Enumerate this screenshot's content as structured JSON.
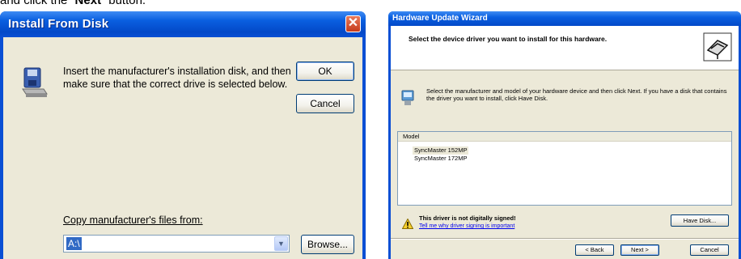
{
  "caption": {
    "prefix": "and click the “",
    "bold": "Next",
    "suffix": "” button."
  },
  "install_dialog": {
    "title": "Install From Disk",
    "close_icon": "close-icon",
    "message": "Insert the manufacturer's installation disk, and then make sure that the correct drive is selected below.",
    "ok_label": "OK",
    "cancel_label": "Cancel",
    "copy_label": "Copy manufacturer's files from:",
    "path_value": "A:\\",
    "browse_label": "Browse..."
  },
  "wizard": {
    "title": "Hardware Update Wizard",
    "heading": "Select the device driver you want to install for this hardware.",
    "instruction": "Select the manufacturer and model of your hardware device and then click Next. If you have a disk that contains the driver you want to install, click Have Disk.",
    "model_header": "Model",
    "models": [
      "SyncMaster 152MP",
      "SyncMaster 172MP"
    ],
    "selected_model": "SyncMaster 152MP",
    "warning_text": "This driver is not digitally signed!",
    "warning_link": "Tell me why driver signing is important",
    "have_disk_label": "Have Disk...",
    "back_label": "< Back",
    "next_label": "Next >",
    "cancel_label": "Cancel"
  }
}
